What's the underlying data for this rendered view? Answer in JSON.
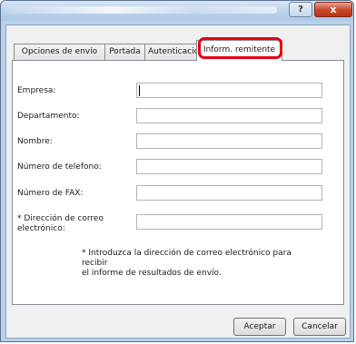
{
  "titlebar": {
    "help_label": "?",
    "close_label": "x"
  },
  "tabs": [
    {
      "label": "Opciones de envío"
    },
    {
      "label": "Portada"
    },
    {
      "label": "Autenticación"
    },
    {
      "label": "Inform. remitente"
    }
  ],
  "form": {
    "company_label": "Empresa:",
    "department_label": "Departamento:",
    "name_label": "Nombre:",
    "phone_label": "Número de telefono:",
    "fax_label": "Número de FAX:",
    "email_label_line1": "* Dirección de correo",
    "email_label_line2": "electrónico:",
    "company_value": "",
    "department_value": "",
    "name_value": "",
    "phone_value": "",
    "fax_value": "",
    "email_value": "",
    "note_line1": "* Introduzca la dirección de correo electrónico para recibir",
    "note_line2": "el informe de resultados de envío."
  },
  "buttons": {
    "ok": "Aceptar",
    "cancel": "Cancelar"
  },
  "colors": {
    "highlight": "#e60012",
    "titlebar": "#b9d1ea",
    "close": "#c84b2f"
  }
}
